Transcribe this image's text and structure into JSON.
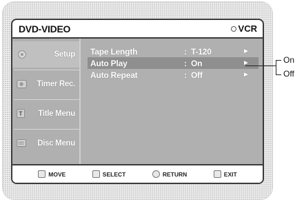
{
  "header": {
    "title": "DVD-VIDEO",
    "mode": "VCR"
  },
  "sidebar": {
    "items": [
      {
        "label": "Setup",
        "icon": "gear-icon",
        "active": true
      },
      {
        "label": "Timer Rec.",
        "icon": "timer-icon",
        "active": false
      },
      {
        "label": "Title Menu",
        "icon": "title-menu-icon",
        "active": false
      },
      {
        "label": "Disc Menu",
        "icon": "disc-menu-icon",
        "active": false
      }
    ]
  },
  "settings": [
    {
      "label": "Tape Length",
      "colon": ":",
      "value": "T-120",
      "arrow": "►"
    },
    {
      "label": "Auto Play",
      "colon": ":",
      "value": "On",
      "arrow": "►"
    },
    {
      "label": "Auto Repeat",
      "colon": ":",
      "value": "Off",
      "arrow": "►"
    }
  ],
  "footer": {
    "move": "MOVE",
    "select": "SELECT",
    "return": "RETURN",
    "exit": "EXIT"
  },
  "callout": {
    "options": [
      "On",
      "Off"
    ]
  }
}
